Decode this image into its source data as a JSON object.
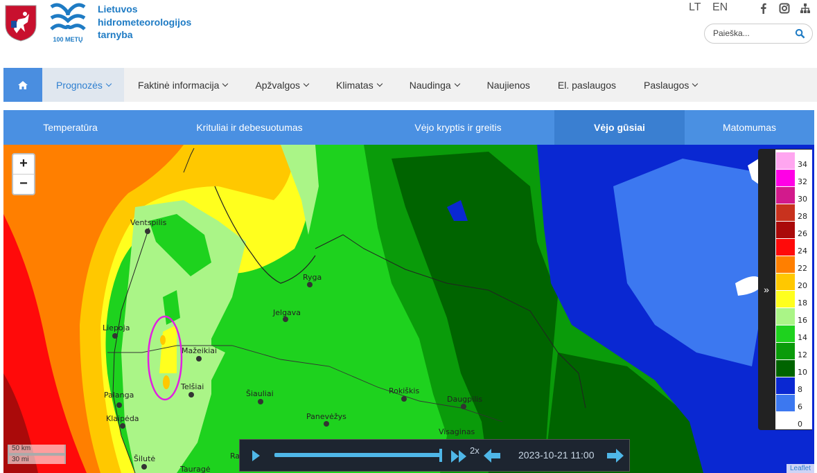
{
  "header": {
    "org_line1": "Lietuvos",
    "org_line2": "hidrometeorologijos",
    "org_line3": "tarnyba",
    "logo_text": "100 METŲ",
    "lang_lt": "LT",
    "lang_en": "EN",
    "search_placeholder": "Paieška..."
  },
  "nav": [
    {
      "label": "Prognozės",
      "dropdown": true,
      "active": true
    },
    {
      "label": "Faktinė informacija",
      "dropdown": true
    },
    {
      "label": "Apžvalgos",
      "dropdown": true
    },
    {
      "label": "Klimatas",
      "dropdown": true
    },
    {
      "label": "Naudinga",
      "dropdown": true
    },
    {
      "label": "Naujienos",
      "dropdown": false
    },
    {
      "label": "El. paslaugos",
      "dropdown": false
    },
    {
      "label": "Paslaugos",
      "dropdown": true
    }
  ],
  "subtabs": [
    {
      "label": "Temperatūra"
    },
    {
      "label": "Krituliai ir debesuotumas"
    },
    {
      "label": "Vėjo kryptis ir greitis"
    },
    {
      "label": "Vėjo gūsiai",
      "active": true
    },
    {
      "label": "Matomumas"
    }
  ],
  "map": {
    "zoom_in": "+",
    "zoom_out": "−",
    "cities": [
      "Ventspilis",
      "Ryga",
      "Jelgava",
      "Liepoja",
      "Mažeikiai",
      "Telšiai",
      "Šiauliai",
      "Rokiškis",
      "Daugpilis",
      "Palanga",
      "Klaipėda",
      "Panevėžys",
      "Visaginas",
      "Šilutė",
      "Tauragė",
      "Ra"
    ],
    "scale_km": "50 km",
    "scale_mi": "30 mi",
    "attribution": "Leaflet"
  },
  "legend": {
    "items": [
      {
        "label": "34",
        "color": "#ffa6f0"
      },
      {
        "label": "32",
        "color": "#ff00e6"
      },
      {
        "label": "30",
        "color": "#d21a8c"
      },
      {
        "label": "28",
        "color": "#c8321e"
      },
      {
        "label": "26",
        "color": "#aa0a0a"
      },
      {
        "label": "24",
        "color": "#ff0a0a"
      },
      {
        "label": "22",
        "color": "#ff7f00"
      },
      {
        "label": "20",
        "color": "#ffc800"
      },
      {
        "label": "18",
        "color": "#ffff1e"
      },
      {
        "label": "16",
        "color": "#aaf587"
      },
      {
        "label": "14",
        "color": "#1ed21e"
      },
      {
        "label": "12",
        "color": "#0a9b0a"
      },
      {
        "label": "10",
        "color": "#006400"
      },
      {
        "label": "8",
        "color": "#0a28d2"
      },
      {
        "label": "6",
        "color": "#3c78f0"
      },
      {
        "label": "0",
        "color": "#ffffff"
      }
    ]
  },
  "player": {
    "speed": "2x",
    "datetime": "2023-10-21 11:00",
    "progress": 1.0
  }
}
